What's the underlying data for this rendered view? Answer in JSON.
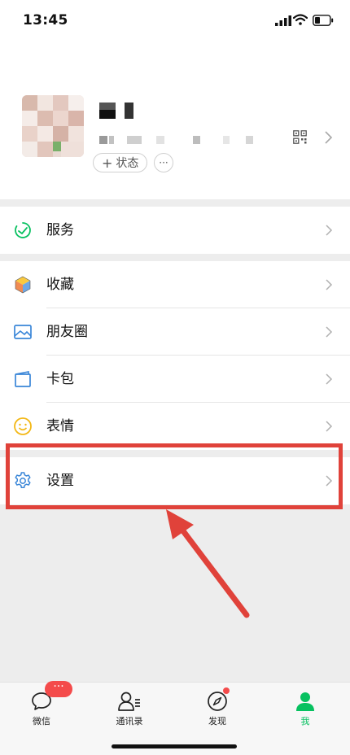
{
  "status_bar": {
    "time": "13:45"
  },
  "profile": {
    "status_label": "状态",
    "status_plus": "+",
    "more_label": "···"
  },
  "menu": {
    "services": "服务",
    "favorites": "收藏",
    "moments": "朋友圈",
    "card_wallet": "卡包",
    "stickers": "表情",
    "settings": "设置"
  },
  "tabbar": {
    "chats": "微信",
    "contacts": "通讯录",
    "discover": "发现",
    "me": "我",
    "chats_badge": "···"
  },
  "colors": {
    "accent": "#07c160",
    "annotation": "#e0423a",
    "badge": "#f44b4b"
  }
}
